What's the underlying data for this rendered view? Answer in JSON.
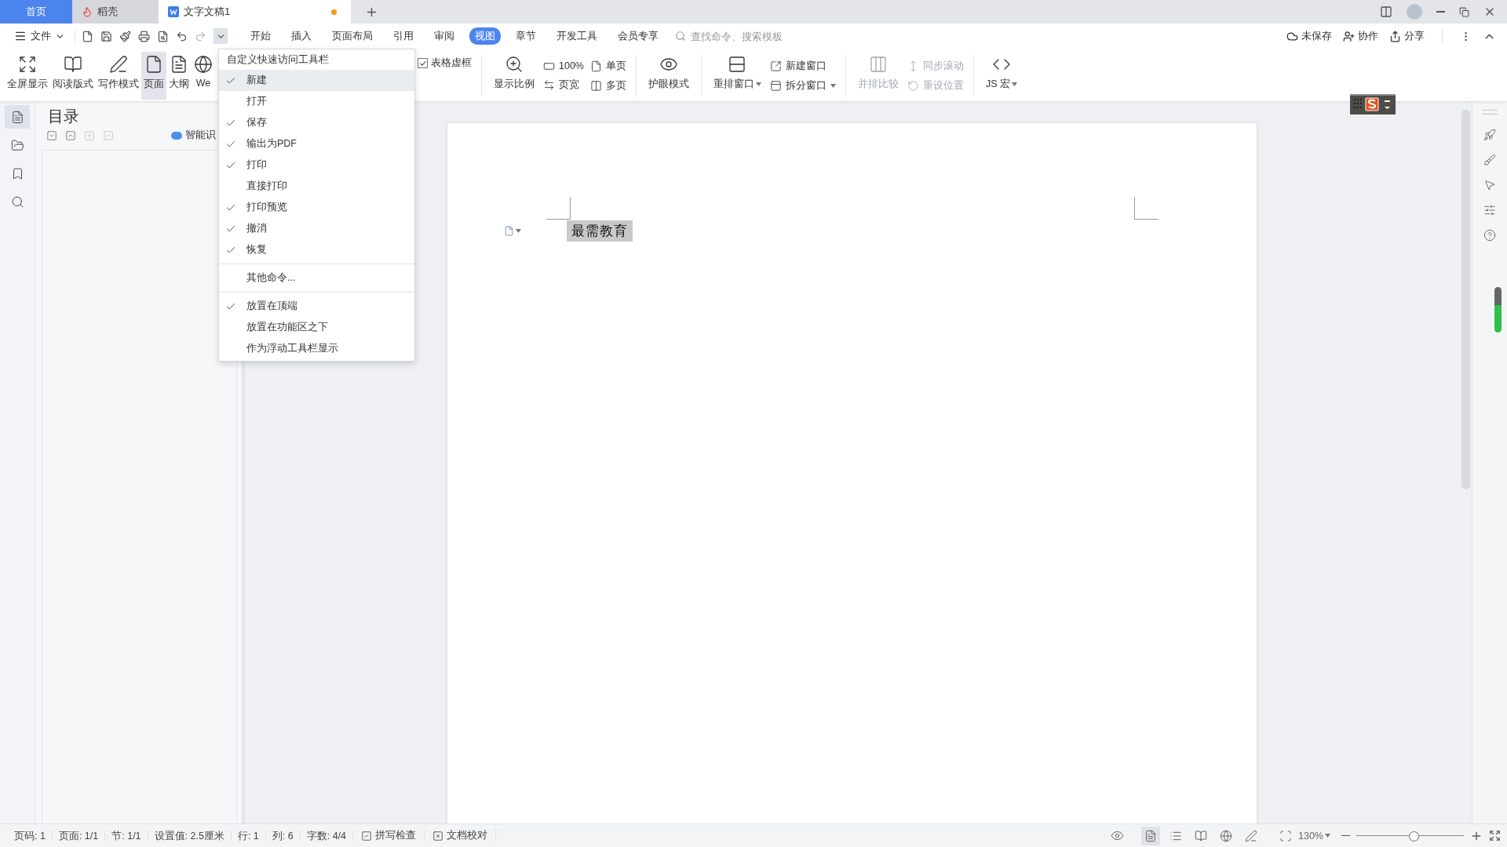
{
  "tabs": [
    {
      "label": "首页",
      "kind": "home",
      "selected": false,
      "modified": false
    },
    {
      "label": "稻壳",
      "kind": "store",
      "selected": false,
      "modified": false
    },
    {
      "label": "文字文稿1",
      "kind": "document",
      "selected": true,
      "modified": true
    }
  ],
  "menu_bar": {
    "file_menu": "文件",
    "customize_open": true,
    "tabs": [
      {
        "label": "开始",
        "selected": false
      },
      {
        "label": "插入",
        "selected": false
      },
      {
        "label": "页面布局",
        "selected": false
      },
      {
        "label": "引用",
        "selected": false
      },
      {
        "label": "审阅",
        "selected": false
      },
      {
        "label": "视图",
        "selected": true
      },
      {
        "label": "章节",
        "selected": false
      },
      {
        "label": "开发工具",
        "selected": false
      },
      {
        "label": "会员专享",
        "selected": false
      }
    ],
    "search": {
      "placeholder": "查找命令、搜索模板"
    },
    "actions": [
      "未保存",
      "协作",
      "分享"
    ]
  },
  "ribbon": {
    "groups": [
      {
        "items": [
          {
            "kind": "large",
            "label": "全屏显示",
            "selected": false,
            "disabled": false,
            "dropdown": false
          },
          {
            "kind": "large",
            "label": "阅读版式",
            "selected": false,
            "disabled": false,
            "dropdown": false
          },
          {
            "kind": "large",
            "label": "写作模式",
            "selected": false,
            "disabled": false,
            "dropdown": false
          },
          {
            "kind": "large",
            "label": "页面",
            "selected": true,
            "disabled": false,
            "dropdown": false
          },
          {
            "kind": "large",
            "label": "大纲",
            "selected": false,
            "disabled": false,
            "dropdown": false
          },
          {
            "kind": "large",
            "label": "We",
            "selected": false,
            "disabled": false,
            "dropdown": false
          }
        ]
      },
      {
        "items": [
          {
            "kind": "check",
            "label": "表格虚框",
            "checked": true
          }
        ]
      },
      {
        "items": [
          {
            "kind": "large",
            "label": "显示比例",
            "disabled": false,
            "dropdown": false
          },
          {
            "kind": "stack",
            "items": [
              {
                "label": "100%",
                "disabled": false,
                "dropdown": false
              },
              {
                "label": "页宽",
                "disabled": false,
                "dropdown": false
              }
            ]
          },
          {
            "kind": "stack",
            "items": [
              {
                "label": "单页",
                "disabled": false,
                "dropdown": false
              },
              {
                "label": "多页",
                "disabled": false,
                "dropdown": false
              }
            ]
          }
        ]
      },
      {
        "items": [
          {
            "kind": "large",
            "label": "护眼模式",
            "disabled": false,
            "dropdown": false
          }
        ]
      },
      {
        "items": [
          {
            "kind": "large",
            "label": "重排窗口",
            "disabled": false,
            "dropdown": true
          },
          {
            "kind": "stack",
            "items": [
              {
                "label": "新建窗口",
                "disabled": false,
                "dropdown": false
              },
              {
                "label": "拆分窗口",
                "disabled": false,
                "dropdown": true
              }
            ]
          }
        ]
      },
      {
        "items": [
          {
            "kind": "large",
            "label": "并排比较",
            "disabled": true,
            "dropdown": false
          },
          {
            "kind": "stack",
            "items": [
              {
                "label": "同步滚动",
                "disabled": true,
                "dropdown": false
              },
              {
                "label": "重设位置",
                "disabled": true,
                "dropdown": false
              }
            ]
          }
        ]
      },
      {
        "items": [
          {
            "kind": "large",
            "label": "JS 宏",
            "disabled": false,
            "dropdown": true
          }
        ]
      }
    ]
  },
  "quick_access_menu": {
    "title": "自定义快速访问工具栏",
    "sections": [
      {
        "items": [
          {
            "label": "新建",
            "checked": true,
            "hovered": true
          },
          {
            "label": "打开",
            "checked": false,
            "hovered": false
          },
          {
            "label": "保存",
            "checked": true,
            "hovered": false
          },
          {
            "label": "输出为PDF",
            "checked": true,
            "hovered": false
          },
          {
            "label": "打印",
            "checked": true,
            "hovered": false
          },
          {
            "label": "直接打印",
            "checked": false,
            "hovered": false
          },
          {
            "label": "打印预览",
            "checked": true,
            "hovered": false
          },
          {
            "label": "撤消",
            "checked": true,
            "hovered": false
          },
          {
            "label": "恢复",
            "checked": true,
            "hovered": false
          }
        ]
      },
      {
        "items": [
          {
            "label": "其他命令...",
            "checked": false,
            "hovered": false
          }
        ]
      },
      {
        "items": [
          {
            "label": "放置在顶端",
            "checked": true,
            "hovered": false
          },
          {
            "label": "放置在功能区之下",
            "checked": false,
            "hovered": false
          },
          {
            "label": "作为浮动工具栏显示",
            "checked": false,
            "hovered": false
          }
        ]
      }
    ]
  },
  "nav_rail": [
    {
      "selected": true
    },
    {
      "selected": false
    },
    {
      "selected": false
    },
    {
      "selected": false
    }
  ],
  "nav_panel": {
    "title": "目录",
    "smart_button": "智能识"
  },
  "document": {
    "text": "最需教育",
    "highlighted": true
  },
  "status_bar": {
    "items": [
      {
        "kind": "text",
        "label": "页码: 1"
      },
      {
        "kind": "text",
        "label": "页面: 1/1"
      },
      {
        "kind": "text",
        "label": "节: 1/1"
      },
      {
        "kind": "text",
        "label": "设置值: 2.5厘米"
      },
      {
        "kind": "text",
        "label": "行: 1"
      },
      {
        "kind": "text",
        "label": "列: 6"
      },
      {
        "kind": "text",
        "label": "字数: 4/4"
      },
      {
        "kind": "check",
        "label": "拼写检查"
      },
      {
        "kind": "cross",
        "label": "文档校对"
      }
    ],
    "view_modes": [
      {
        "selected": true
      },
      {
        "selected": false
      },
      {
        "selected": false
      },
      {
        "selected": false
      },
      {
        "selected": false
      }
    ],
    "zoom": "130%",
    "zoom_slider": {
      "level": 0.53
    }
  }
}
